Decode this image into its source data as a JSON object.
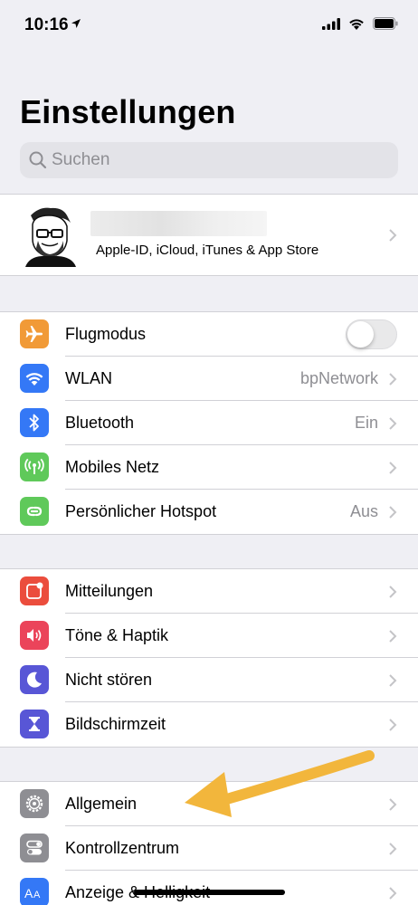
{
  "status_bar": {
    "time": "10:16"
  },
  "title": "Einstellungen",
  "search": {
    "placeholder": "Suchen"
  },
  "profile": {
    "subtitle": "Apple-ID, iCloud, iTunes & App Store"
  },
  "group1": [
    {
      "label": "Flugmodus",
      "icon": "airplane-icon",
      "color": "#f19a37",
      "toggle": false
    },
    {
      "label": "WLAN",
      "value": "bpNetwork",
      "icon": "wifi-icon",
      "color": "#3478f6"
    },
    {
      "label": "Bluetooth",
      "value": "Ein",
      "icon": "bluetooth-icon",
      "color": "#3478f6"
    },
    {
      "label": "Mobiles Netz",
      "icon": "cellular-icon",
      "color": "#5fc95a"
    },
    {
      "label": "Persönlicher Hotspot",
      "value": "Aus",
      "icon": "hotspot-icon",
      "color": "#5fc95a"
    }
  ],
  "group2": [
    {
      "label": "Mitteilungen",
      "icon": "notifications-icon",
      "color": "#eb4d3d"
    },
    {
      "label": "Töne & Haptik",
      "icon": "sounds-icon",
      "color": "#eb445a"
    },
    {
      "label": "Nicht stören",
      "icon": "moon-icon",
      "color": "#5856d6"
    },
    {
      "label": "Bildschirmzeit",
      "icon": "hourglass-icon",
      "color": "#5856d6"
    }
  ],
  "group3": [
    {
      "label": "Allgemein",
      "icon": "gear-icon",
      "color": "#8e8e93"
    },
    {
      "label": "Kontrollzentrum",
      "icon": "switches-icon",
      "color": "#8e8e93"
    },
    {
      "label": "Anzeige & Helligkeit",
      "icon": "display-icon",
      "color": "#3478f6"
    }
  ],
  "annotation": {
    "arrow_color": "#f2b63c"
  }
}
